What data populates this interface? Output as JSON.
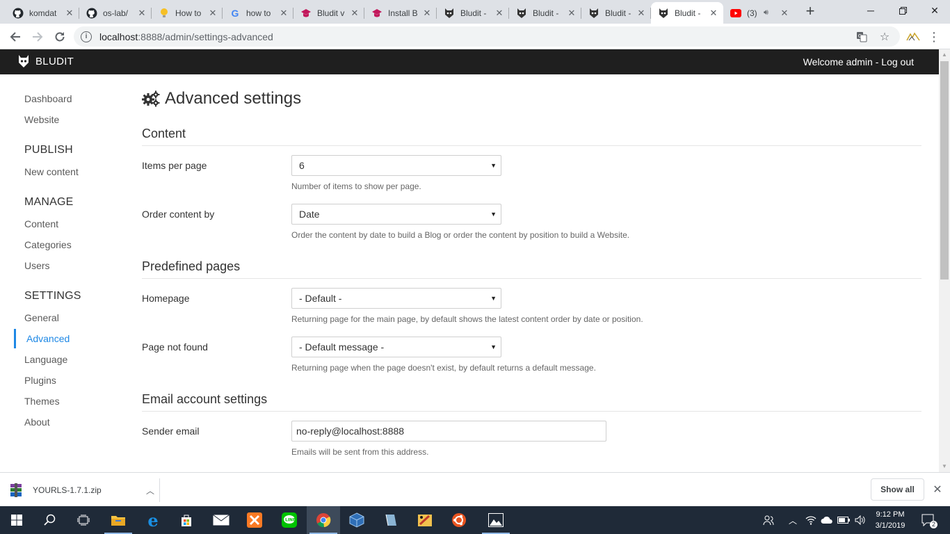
{
  "browser": {
    "tabs": [
      {
        "title": "komdat",
        "icon": "github-icon",
        "left": 0
      },
      {
        "title": "os-lab/",
        "icon": "github-icon"
      },
      {
        "title": "How to",
        "icon": "lightbulb-icon"
      },
      {
        "title": "how to",
        "icon": "google-icon"
      },
      {
        "title": "Bludit v",
        "icon": "graduation-cap-icon"
      },
      {
        "title": "Install B",
        "icon": "graduation-cap-icon"
      },
      {
        "title": "Bludit -",
        "icon": "bludit-icon"
      },
      {
        "title": "Bludit -",
        "icon": "bludit-icon"
      },
      {
        "title": "Bludit -",
        "icon": "bludit-icon"
      },
      {
        "title": "Bludit -",
        "icon": "bludit-icon",
        "active": true
      },
      {
        "title": "(3)",
        "icon": "youtube-icon",
        "audio": true
      }
    ],
    "url_host": "localhost",
    "url_path": ":8888/admin/settings-advanced"
  },
  "app": {
    "brand": "BLUDIT",
    "welcome": "Welcome admin",
    "separator": " - ",
    "logout": "Log out"
  },
  "sidebar": {
    "dashboard": "Dashboard",
    "website": "Website",
    "publish_head": "PUBLISH",
    "new_content": "New content",
    "manage_head": "MANAGE",
    "content": "Content",
    "categories": "Categories",
    "users": "Users",
    "settings_head": "SETTINGS",
    "general": "General",
    "advanced": "Advanced",
    "language": "Language",
    "plugins": "Plugins",
    "themes": "Themes",
    "about": "About"
  },
  "main": {
    "title": "Advanced settings",
    "content_section": "Content",
    "items_per_page_label": "Items per page",
    "items_per_page_value": "6",
    "items_per_page_help": "Number of items to show per page.",
    "order_by_label": "Order content by",
    "order_by_value": "Date",
    "order_by_help": "Order the content by date to build a Blog or order the content by position to build a Website.",
    "predefined_section": "Predefined pages",
    "homepage_label": "Homepage",
    "homepage_value": "- Default -",
    "homepage_help": "Returning page for the main page, by default shows the latest content order by date or position.",
    "notfound_label": "Page not found",
    "notfound_value": "- Default message -",
    "notfound_help": "Returning page when the page doesn't exist, by default returns a default message.",
    "email_section": "Email account settings",
    "sender_label": "Sender email",
    "sender_value": "no-reply@localhost:8888",
    "sender_help": "Emails will be sent from this address."
  },
  "downloads": {
    "file": "YOURLS-1.7.1.zip",
    "show_all": "Show all"
  },
  "taskbar": {
    "time": "9:12 PM",
    "date": "3/1/2019",
    "notifications": "2"
  },
  "colors": {
    "accent": "#1e88e5",
    "topbar": "#1f1f1f",
    "taskbar": "#1f2a38"
  }
}
